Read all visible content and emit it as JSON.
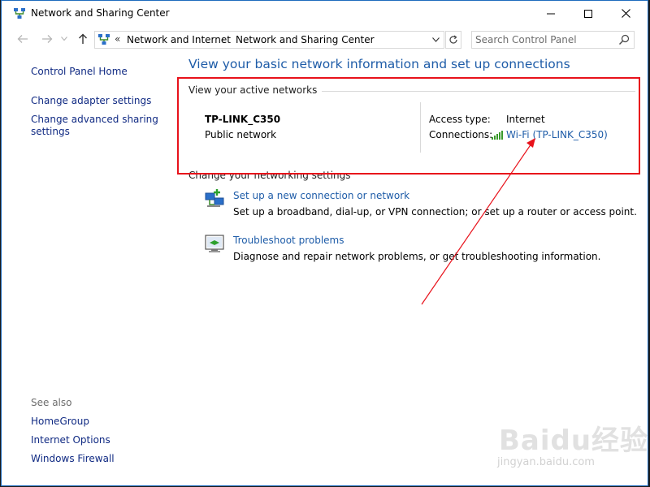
{
  "window": {
    "title": "Network and Sharing Center"
  },
  "navbar": {
    "breadcrumb_prefix": "«",
    "breadcrumbs": [
      "Network and Internet",
      "Network and Sharing Center"
    ],
    "crumb_separator": "›",
    "search_placeholder": "Search Control Panel"
  },
  "sidebar": {
    "home_label": "Control Panel Home",
    "links": [
      "Change adapter settings",
      "Change advanced sharing settings"
    ],
    "see_also_label": "See also",
    "see_also": [
      "HomeGroup",
      "Internet Options",
      "Windows Firewall"
    ]
  },
  "main": {
    "heading": "View your basic network information and set up connections",
    "active_networks_label": "View your active networks",
    "network": {
      "name": "TP-LINK_C350",
      "type": "Public network",
      "access_type_label": "Access type:",
      "access_type_value": "Internet",
      "connections_label": "Connections:",
      "connection_value": "Wi-Fi (TP-LINK_C350)"
    },
    "change_settings_label": "Change your networking settings",
    "tasks": [
      {
        "link": "Set up a new connection or network",
        "description": "Set up a broadband, dial-up, or VPN connection; or set up a router or access point."
      },
      {
        "link": "Troubleshoot problems",
        "description": "Diagnose and repair network problems, or get troubleshooting information."
      }
    ]
  },
  "watermark": {
    "logo_text": "Baidu经验",
    "url": "jingyan.baidu.com"
  },
  "colors": {
    "heading_blue": "#1e5ca8",
    "annotation_red": "#e8121b",
    "window_border": "#1e6bbd"
  }
}
